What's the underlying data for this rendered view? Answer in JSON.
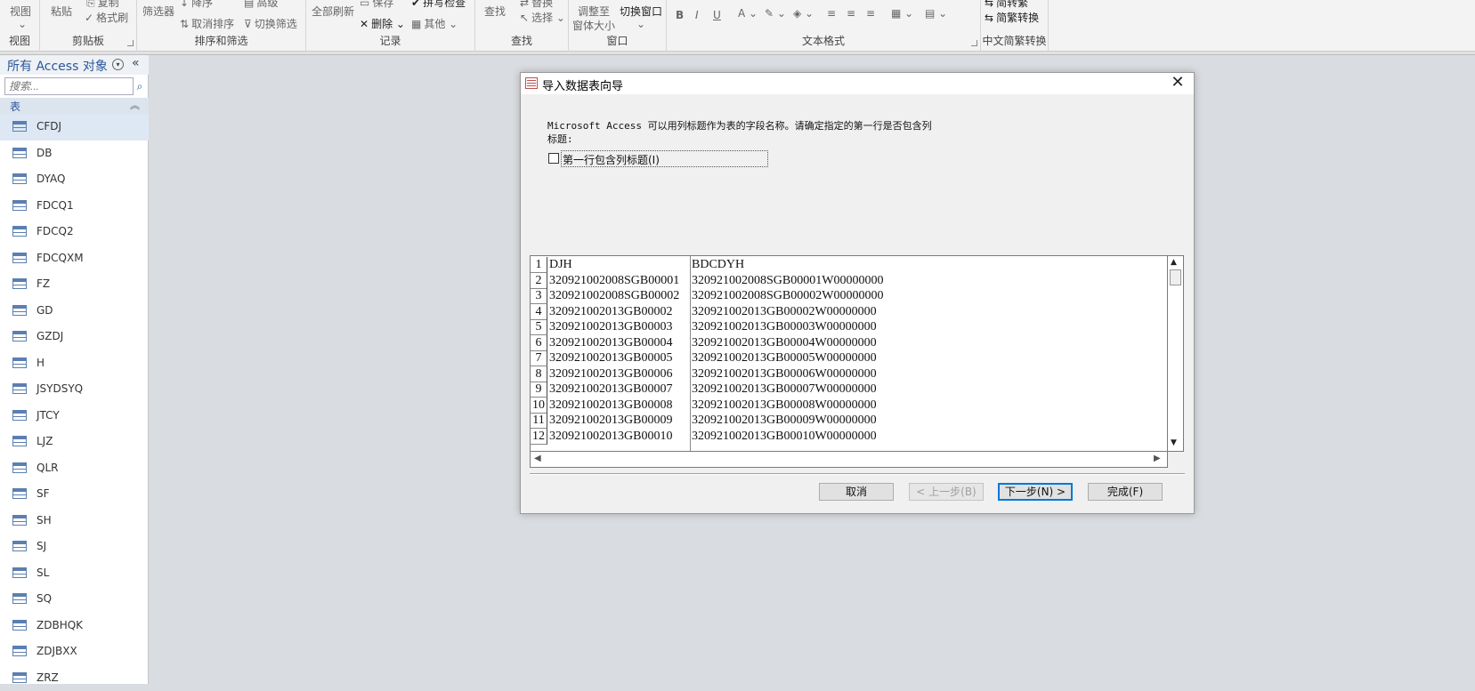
{
  "ribbon": {
    "view_group": {
      "view_button": "视图",
      "label": "视图"
    },
    "clipboard": {
      "paste": "粘贴",
      "copy": "复制",
      "format_painter": "格式刷",
      "label": "剪贴板"
    },
    "sort_filter": {
      "filter": "筛选器",
      "descending": "降序",
      "clear_sort": "取消排序",
      "advanced": "高级",
      "toggle_filter": "切换筛选",
      "label": "排序和筛选"
    },
    "records": {
      "refresh_all": "全部刷新",
      "save": "保存",
      "delete": "删除",
      "spelling": "拼写检查",
      "other": "其他",
      "label": "记录"
    },
    "find": {
      "find": "查找",
      "replace": "替换",
      "select": "选择",
      "label": "查找"
    },
    "window": {
      "fit_window": "调整至",
      "fit_window_2": "窗体大小",
      "switch_windows": "切换窗口",
      "label": "窗口"
    },
    "text_format": {
      "label": "文本格式"
    },
    "chinese_conversion": {
      "to_simplified": "简转繁",
      "trad_simp": "简繁转换",
      "label": "中文简繁转换"
    }
  },
  "nav": {
    "title": "所有 Access 对象",
    "search_placeholder": "搜索...",
    "group_label": "表",
    "tables": [
      "CFDJ",
      "DB",
      "DYAQ",
      "FDCQ1",
      "FDCQ2",
      "FDCQXM",
      "FZ",
      "GD",
      "GZDJ",
      "H",
      "JSYDSYQ",
      "JTCY",
      "LJZ",
      "QLR",
      "SF",
      "SH",
      "SJ",
      "SL",
      "SQ",
      "ZDBHQK",
      "ZDJBXX",
      "ZRZ"
    ],
    "selected": "CFDJ"
  },
  "dialog": {
    "title": "导入数据表向导",
    "message_line1": "Microsoft Access 可以用列标题作为表的字段名称。请确定指定的第一行是否包含列",
    "message_line2": "标题:",
    "checkbox_label": "第一行包含列标题(I)",
    "checkbox_checked": false,
    "preview": {
      "rows": [
        [
          "1",
          "DJH",
          "BDCDYH"
        ],
        [
          "2",
          "320921002008SGB00001",
          "320921002008SGB00001W00000000"
        ],
        [
          "3",
          "320921002008SGB00002",
          "320921002008SGB00002W00000000"
        ],
        [
          "4",
          "320921002013GB00002",
          "320921002013GB00002W00000000"
        ],
        [
          "5",
          "320921002013GB00003",
          "320921002013GB00003W00000000"
        ],
        [
          "6",
          "320921002013GB00004",
          "320921002013GB00004W00000000"
        ],
        [
          "7",
          "320921002013GB00005",
          "320921002013GB00005W00000000"
        ],
        [
          "8",
          "320921002013GB00006",
          "320921002013GB00006W00000000"
        ],
        [
          "9",
          "320921002013GB00007",
          "320921002013GB00007W00000000"
        ],
        [
          "10",
          "320921002013GB00008",
          "320921002013GB00008W00000000"
        ],
        [
          "11",
          "320921002013GB00009",
          "320921002013GB00009W00000000"
        ],
        [
          "12",
          "320921002013GB00010",
          "320921002013GB00010W00000000"
        ]
      ]
    },
    "buttons": {
      "cancel": "取消",
      "back": "< 上一步(B)",
      "next": "下一步(N) >",
      "finish": "完成(F)"
    }
  }
}
